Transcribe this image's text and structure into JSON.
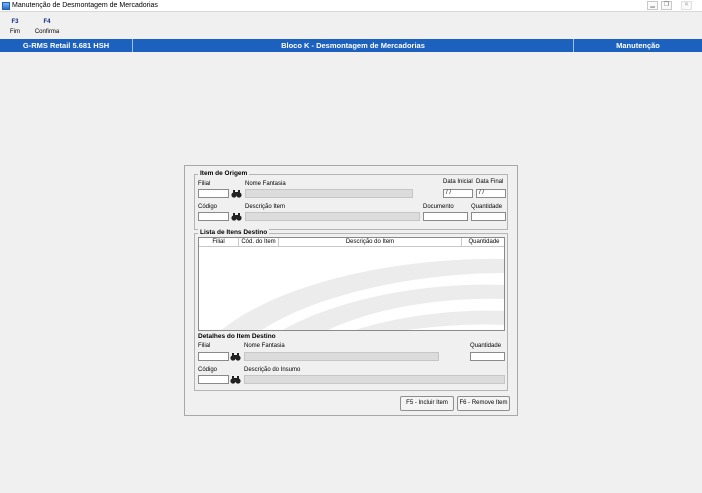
{
  "window": {
    "title": "Manutenção de Desmontagem de Mercadorias"
  },
  "toolbar": [
    {
      "key": "F3",
      "label": "Fim"
    },
    {
      "key": "F4",
      "label": "Confirma"
    }
  ],
  "statusbar": {
    "app": "G-RMS Retail 5.681 HSH",
    "screen": "Bloco K - Desmontagem de Mercadorias",
    "mode": "Manutenção"
  },
  "origem": {
    "title": "Item de Origem",
    "filial_label": "Filial",
    "fantasia_label": "Nome Fantasia",
    "data_inicial_label": "Data Inicial",
    "data_inicial_value": " / /",
    "data_final_label": "Data Final",
    "data_final_value": " / /",
    "codigo_label": "Código",
    "descricao_label": "Descrição Item",
    "documento_label": "Documento",
    "quantidade_label": "Quantidade"
  },
  "lista": {
    "title": "Lista de Itens Destino",
    "columns": [
      "Filial",
      "Cód. do Item",
      "Descrição do Item",
      "Quantidade"
    ]
  },
  "detalhes": {
    "title": "Detalhes do Item Destino",
    "filial_label": "Filial",
    "fantasia_label": "Nome Fantasia",
    "quantidade_label": "Quantidade",
    "codigo_label": "Código",
    "insumo_label": "Descrição do Insumo"
  },
  "buttons": {
    "incluir": "F5 - Incluir Item",
    "remover": "F6 - Remove Item"
  }
}
